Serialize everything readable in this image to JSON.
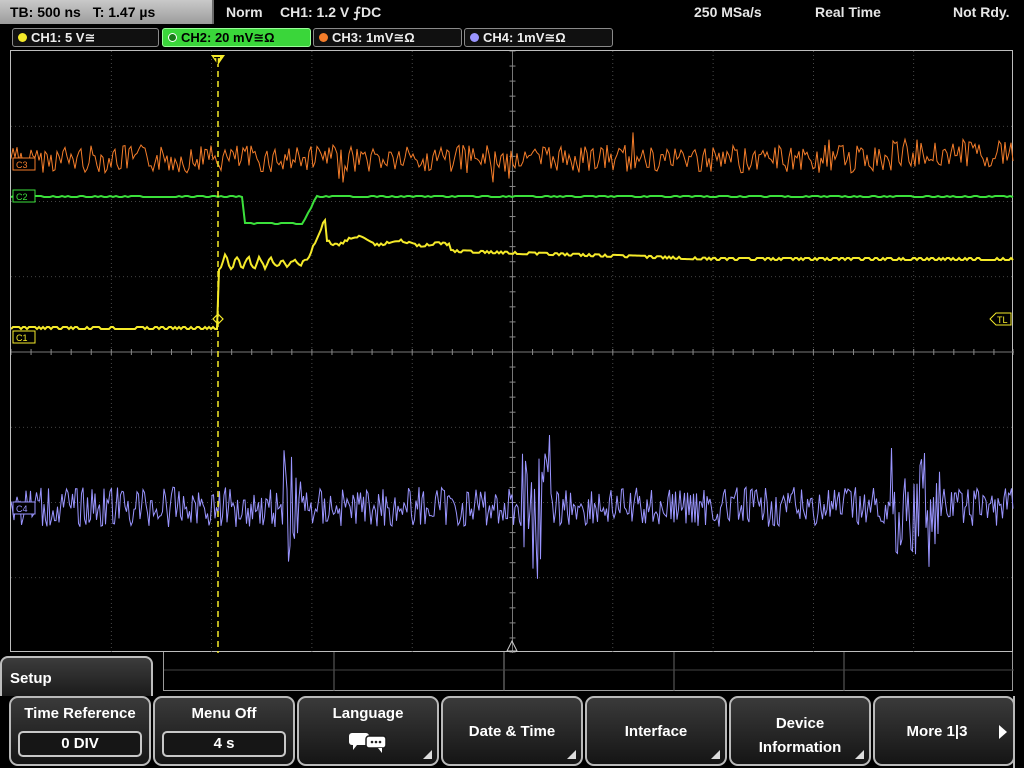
{
  "status": {
    "timebase": "TB: 500 ns",
    "trigger_time": "T: 1.47 µs",
    "mode": "Norm",
    "trigger": "CH1: 1.2 V ⨍DC",
    "sample_rate": "250 MSa/s",
    "acq": "Real Time",
    "state": "Not Rdy."
  },
  "channels": [
    {
      "label": "CH1: 5 V≅",
      "color": "#f5ea2a",
      "active": false
    },
    {
      "label": "CH2: 20 mV≅Ω",
      "color": "#3be03b",
      "active": true
    },
    {
      "label": "CH3: 1mV≅Ω",
      "color": "#f47d2a",
      "active": false
    },
    {
      "label": "CH4: 1mV≅Ω",
      "color": "#9a95ff",
      "active": false
    }
  ],
  "markers": {
    "c1": "C1",
    "c2": "C2",
    "c3": "C3",
    "c4": "C4",
    "trigger_level": "TL",
    "trigger_marker": "T"
  },
  "menu": {
    "title": "Setup",
    "softkeys": [
      {
        "id": "time-reference",
        "label": "Time Reference",
        "value": "0 DIV"
      },
      {
        "id": "menu-off",
        "label": "Menu Off",
        "value": "4 s"
      },
      {
        "id": "language",
        "label": "Language",
        "value": ""
      },
      {
        "id": "date-time",
        "label": "Date & Time",
        "value": ""
      },
      {
        "id": "interface",
        "label": "Interface",
        "value": ""
      },
      {
        "id": "device-information",
        "label": "Device Information",
        "value": ""
      },
      {
        "id": "more",
        "label": "More 1|3",
        "value": ""
      }
    ]
  },
  "colors": {
    "grid": "#5a5a5a",
    "ch1": "#f5ea2a",
    "ch2": "#3be03b",
    "ch3": "#f47d2a",
    "ch4": "#9a95ff"
  }
}
